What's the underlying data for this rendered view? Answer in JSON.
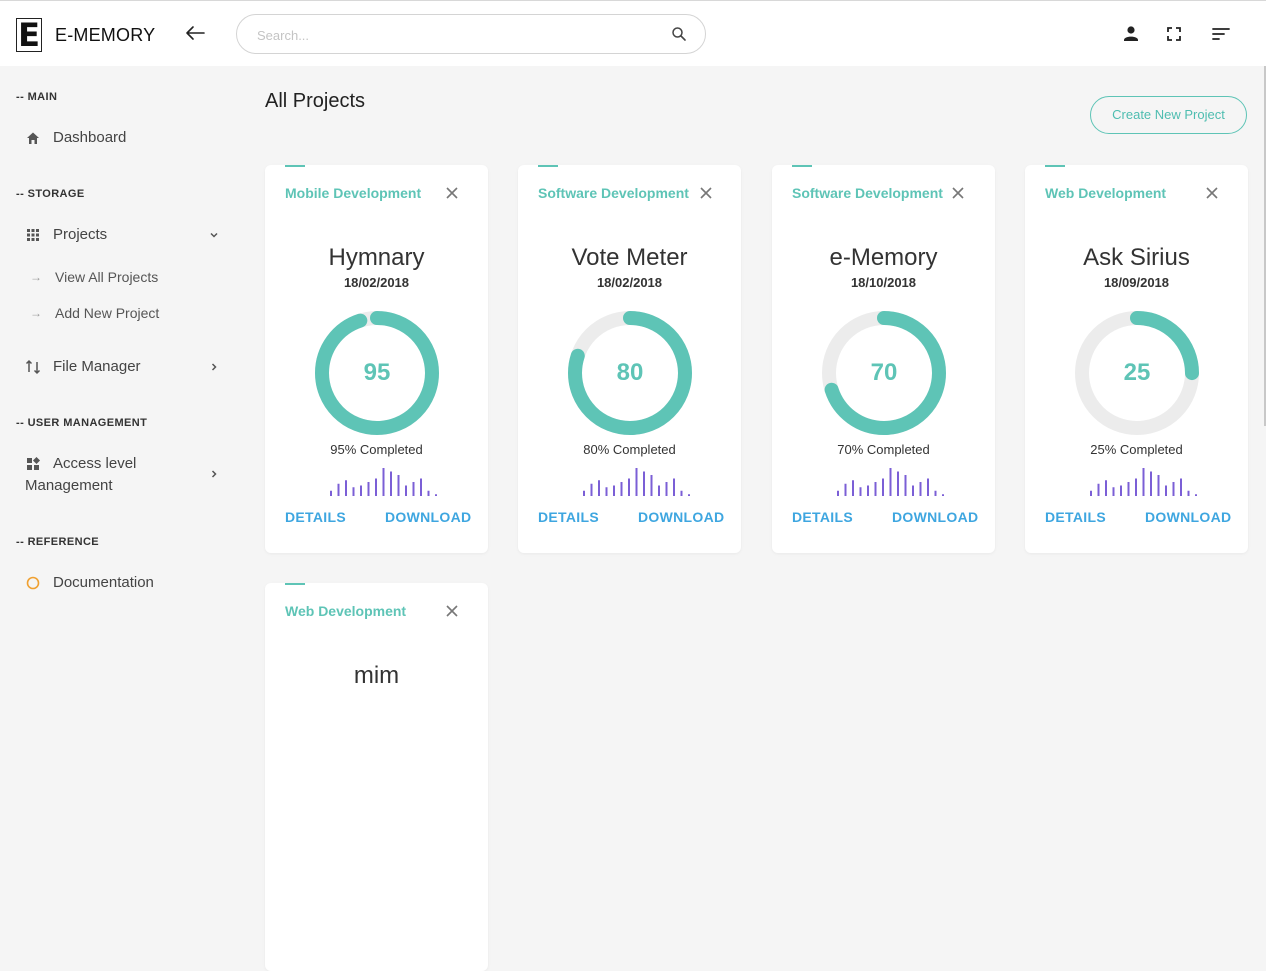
{
  "header": {
    "logo_letter": "E",
    "app_name": "E-MEMORY",
    "search_placeholder": "Search...",
    "icons": [
      "back-arrow-icon",
      "search-icon",
      "user-icon",
      "fullscreen-icon",
      "sort-lines-icon"
    ]
  },
  "sidebar": {
    "sections": {
      "main": "-- MAIN",
      "storage": "-- STORAGE",
      "user_management": "-- USER MANAGEMENT",
      "reference": "-- REFERENCE"
    },
    "items": {
      "dashboard": "Dashboard",
      "projects": "Projects",
      "view_all": "View All Projects",
      "add_new": "Add New Project",
      "file_manager": "File Manager",
      "access_level_1": "Access level",
      "access_level_2": "Management",
      "documentation": "Documentation"
    },
    "sub_arrow": "→"
  },
  "main": {
    "title": "All Projects",
    "create_button": "Create New Project",
    "details_label": "DETAILS",
    "download_label": "DOWNLOAD",
    "completed_suffix": "% Completed",
    "accent_color": "#5ec4b6",
    "sparkline_color": "#7b5fd6",
    "sparkline_values": [
      3,
      7,
      9,
      5,
      6,
      8,
      10,
      16,
      14,
      12,
      6,
      8,
      10,
      3,
      1
    ],
    "projects": [
      {
        "category": "Mobile Development",
        "name": "Hymnary",
        "date": "18/02/2018",
        "progress": 95,
        "progress_label": "95",
        "completed": "95% Completed"
      },
      {
        "category": "Software Development",
        "name": "Vote Meter",
        "date": "18/02/2018",
        "progress": 80,
        "progress_label": "80",
        "completed": "80% Completed"
      },
      {
        "category": "Software Development",
        "name": "e-Memory",
        "date": "18/10/2018",
        "progress": 70,
        "progress_label": "70",
        "completed": "70% Completed"
      },
      {
        "category": "Web Development",
        "name": "Ask Sirius",
        "date": "18/09/2018",
        "progress": 25,
        "progress_label": "25",
        "completed": "25% Completed"
      },
      {
        "category": "Web Development",
        "name": "mim",
        "date": "",
        "progress": null,
        "progress_label": "",
        "completed": ""
      }
    ]
  }
}
